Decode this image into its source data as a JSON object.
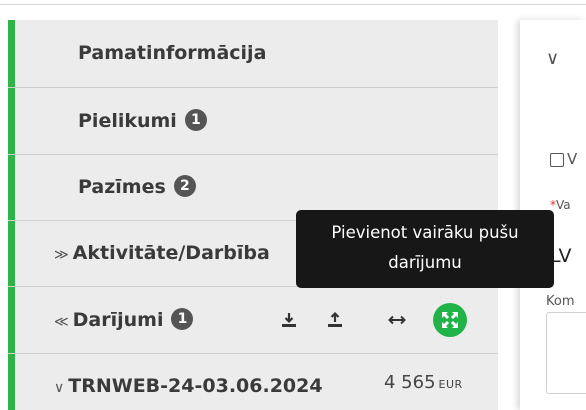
{
  "sidebar": {
    "items": [
      {
        "label": "Pamatinformācija"
      },
      {
        "label": "Pielikumi",
        "badge": "1"
      },
      {
        "label": "Pazīmes",
        "badge": "2"
      },
      {
        "label": "Aktivitāte/Darbība",
        "caret": "≫"
      },
      {
        "label": "Darījumi",
        "badge": "1",
        "caret": "≪"
      },
      {
        "label": "TRNWEB-24-03.06.2024",
        "caret": "∨",
        "amount": "4 565",
        "currency": "EUR"
      }
    ],
    "accent_color": "#2db34a"
  },
  "toolbar": {
    "download_icon": "download-icon",
    "upload_icon": "upload-icon",
    "swap_icon": "swap-horizontal-icon",
    "expand_icon": "expand-icon"
  },
  "tooltip": {
    "line1": "Pievienot vairāku pušu",
    "line2": "darījumu"
  },
  "panel": {
    "chevron": "∨",
    "checkbox_label": "V",
    "required_mark": "*",
    "field_label": "Va",
    "field_value": "LV",
    "comment_label": "Kom"
  }
}
